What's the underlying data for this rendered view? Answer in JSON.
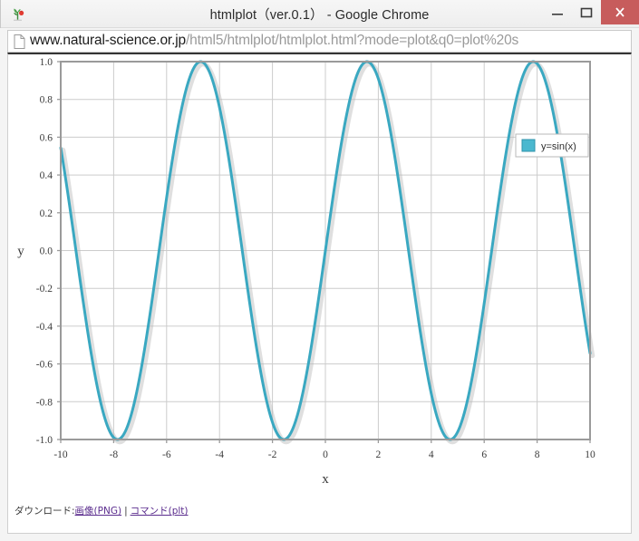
{
  "window": {
    "title": "htmlplot（ver.0.1） - Google Chrome",
    "favicon_name": "plant-favicon",
    "controls": {
      "minimize": "minimize",
      "maximize": "maximize",
      "close": "close"
    }
  },
  "urlbar": {
    "page_icon": "document-icon",
    "host": "www.natural-science.or.jp",
    "path": "/html5/htmlplot/htmlplot.html?mode=plot&q0=plot%20s",
    "full_url": "www.natural-science.or.jp/html5/htmlplot/htmlplot.html?mode=plot&q0=plot%20s"
  },
  "download": {
    "label": "ダウンロード:",
    "image_link": "画像(PNG)",
    "separator": "|",
    "command_link": "コマンド(plt)"
  },
  "colors": {
    "curve": "#3aa8c1",
    "grid": "#cccccc",
    "frame": "#9a9a9a",
    "close_button": "#c75c5c",
    "link": "#5b2d8e"
  },
  "chart_data": {
    "type": "line",
    "title": "",
    "xlabel": "x",
    "ylabel": "y",
    "xlim": [
      -10,
      10
    ],
    "ylim": [
      -1.0,
      1.0
    ],
    "xticks": [
      -10,
      -8,
      -6,
      -4,
      -2,
      0,
      2,
      4,
      6,
      8,
      10
    ],
    "xtick_labels": [
      "-10",
      "-8",
      "-6",
      "-4",
      "-2",
      "0",
      "2",
      "4",
      "6",
      "8",
      "10"
    ],
    "yticks": [
      -1.0,
      -0.8,
      -0.6,
      -0.4,
      -0.2,
      0.0,
      0.2,
      0.4,
      0.6,
      0.8,
      1.0
    ],
    "ytick_labels": [
      "-1.0",
      "-0.8",
      "-0.6",
      "-0.4",
      "-0.2",
      "0.0",
      "0.2",
      "0.4",
      "0.6",
      "0.8",
      "1.0"
    ],
    "grid": true,
    "legend_position": "top-right",
    "series": [
      {
        "name": "y=sin(x)",
        "function": "sin",
        "color": "#3aa8c1",
        "linewidth": 3,
        "x": [
          -10,
          -9.5,
          -9,
          -8.5,
          -8,
          -7.5,
          -7,
          -6.5,
          -6,
          -5.5,
          -5,
          -4.5,
          -4,
          -3.5,
          -3,
          -2.5,
          -2,
          -1.5,
          -1,
          -0.5,
          0,
          0.5,
          1,
          1.5,
          2,
          2.5,
          3,
          3.5,
          4,
          4.5,
          5,
          5.5,
          6,
          6.5,
          7,
          7.5,
          8,
          8.5,
          9,
          9.5,
          10
        ],
        "y": [
          0.544,
          -0.075,
          -0.412,
          -0.798,
          -0.989,
          -0.938,
          -0.657,
          -0.215,
          0.279,
          0.706,
          0.959,
          0.978,
          0.757,
          0.351,
          -0.141,
          -0.599,
          -0.909,
          -0.997,
          -0.841,
          -0.479,
          0.0,
          0.479,
          0.841,
          0.997,
          0.909,
          0.599,
          0.141,
          -0.351,
          -0.757,
          -0.978,
          -0.959,
          -0.706,
          -0.279,
          0.215,
          0.657,
          0.938,
          0.989,
          0.798,
          0.412,
          0.075,
          -0.544
        ]
      }
    ]
  }
}
